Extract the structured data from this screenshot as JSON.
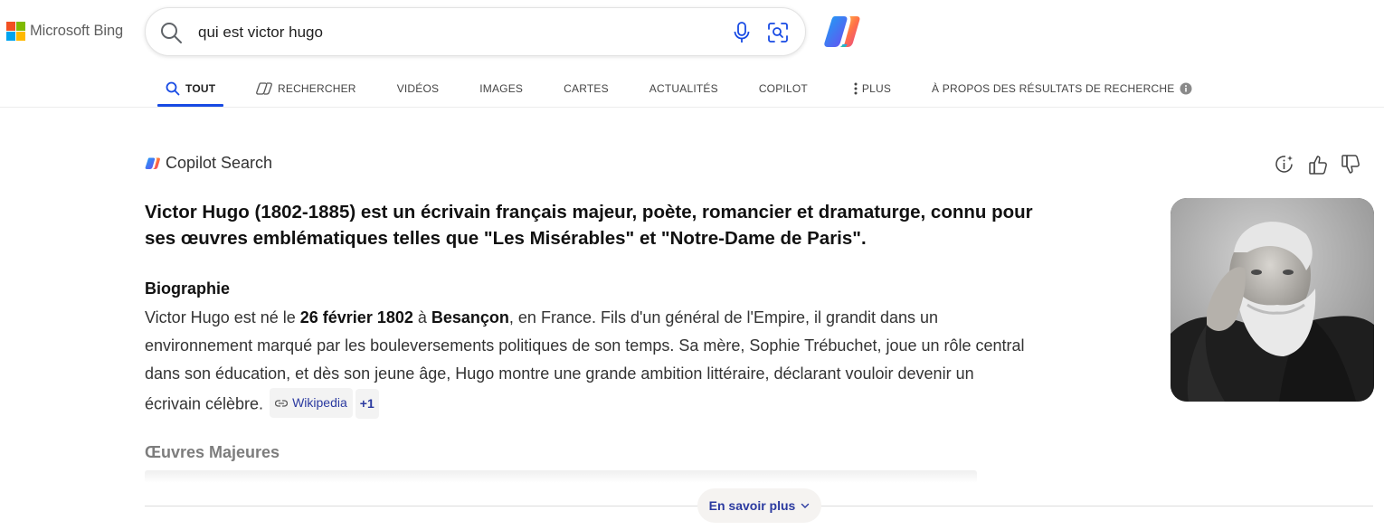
{
  "header": {
    "logo_text": "Microsoft Bing",
    "search_value": "qui est victor hugo"
  },
  "tabs": [
    {
      "label": "TOUT",
      "icon": "search-icon",
      "active": true
    },
    {
      "label": "RECHERCHER",
      "icon": "copilot-search-icon"
    },
    {
      "label": "VIDÉOS"
    },
    {
      "label": "IMAGES"
    },
    {
      "label": "CARTES"
    },
    {
      "label": "ACTUALITÉS"
    },
    {
      "label": "COPILOT"
    },
    {
      "label": "PLUS",
      "icon": "more-vertical-icon"
    },
    {
      "label": "À PROPOS DES RÉSULTATS DE RECHERCHE",
      "icon": "info-icon"
    }
  ],
  "answer": {
    "brand": "Copilot Search",
    "summary": "Victor Hugo (1802-1885) est un écrivain français majeur, poète, romancier et dramaturge, connu pour ses œuvres emblématiques telles que \"Les Misérables\" et \"Notre-Dame de Paris\".",
    "bio_heading": "Biographie",
    "bio": {
      "t1": "Victor Hugo est né le ",
      "b1": "26 février 1802",
      "t2": " à ",
      "b2": "Besançon",
      "t3": ", en France. Fils d'un général de l'Empire, il grandit dans un environnement marqué par les bouleversements politiques de son temps. Sa mère, Sophie Trébuchet, joue un rôle central dans son éducation, et dès son jeune âge, Hugo montre une grande ambition littéraire, déclarant vouloir devenir un écrivain célèbre."
    },
    "citation": "Wikipedia",
    "citation_more": "+1",
    "next_heading": "Œuvres Majeures",
    "more_button": "En savoir plus"
  },
  "colors": {
    "accent": "#174ae4",
    "link": "#2b3aa0"
  }
}
